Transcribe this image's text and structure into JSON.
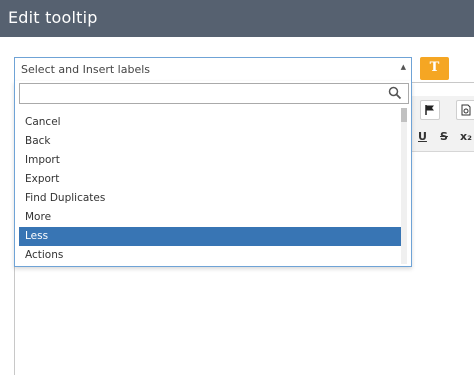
{
  "dialog": {
    "title": "Edit tooltip"
  },
  "label_select": {
    "selected_text": "Select and Insert labels",
    "search_placeholder": "",
    "options": [
      {
        "label": "Cancel"
      },
      {
        "label": "Back"
      },
      {
        "label": "Import"
      },
      {
        "label": "Export"
      },
      {
        "label": "Find Duplicates"
      },
      {
        "label": "More"
      },
      {
        "label": "Less"
      },
      {
        "label": "Actions"
      }
    ],
    "highlighted_option": "Less"
  },
  "format_button": {
    "icon": "text-format-icon",
    "glyph": "T"
  },
  "editor_toolbar": {
    "items": [
      {
        "icon": "flag-icon"
      },
      {
        "icon": "document-icon"
      },
      {
        "icon": "underline-icon",
        "glyph": "U"
      },
      {
        "icon": "strikethrough-icon",
        "glyph": "S"
      },
      {
        "icon": "subscript-icon",
        "glyph": "x₂"
      }
    ]
  },
  "colors": {
    "title_bar": "#566170",
    "accent_orange": "#f5a623",
    "highlight": "#3875b4",
    "select_border": "#6fa3d6"
  }
}
